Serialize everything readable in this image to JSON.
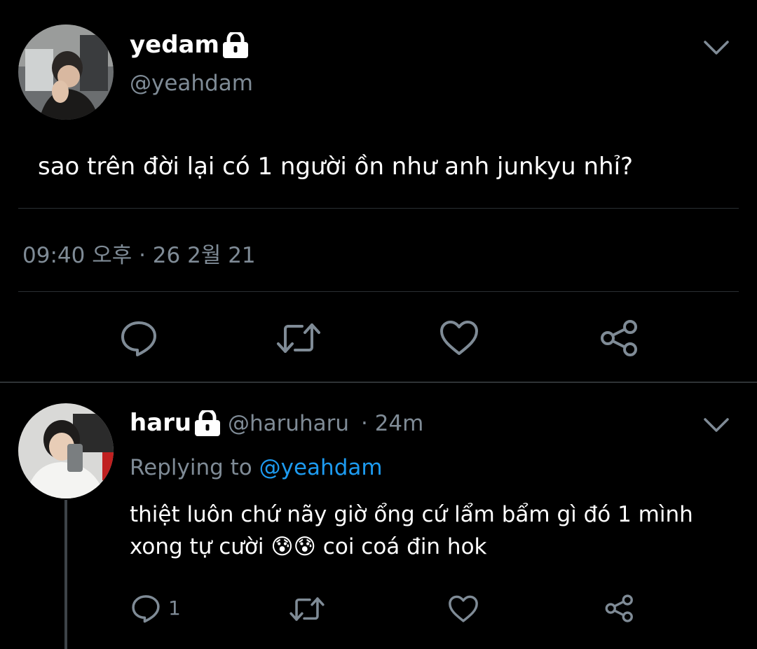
{
  "main_tweet": {
    "author_name": "yedam",
    "handle": "@yeahdam",
    "text": "sao trên đời lại có 1 người ồn như anh junkyu nhỉ?",
    "timestamp": "09:40 오후 · 26 2월 21",
    "actions": [
      "reply-icon",
      "retweet-icon",
      "like-icon",
      "share-icon"
    ]
  },
  "reply": {
    "author_name": "haru",
    "handle": "@haruharu",
    "time": "· 24m",
    "replying_prefix": "Replying to",
    "replying_to": "@yeahdam",
    "text": "thiệt luôn chứ nãy giờ ổng cứ lẩm bẩm gì đó 1 mình xong tự cười 😰😰 coi coá đin hok",
    "reply_count": "1"
  },
  "colors": {
    "background": "#000000",
    "muted": "#7f8b96",
    "link": "#1d9bf0",
    "divider": "#2a2f33"
  }
}
